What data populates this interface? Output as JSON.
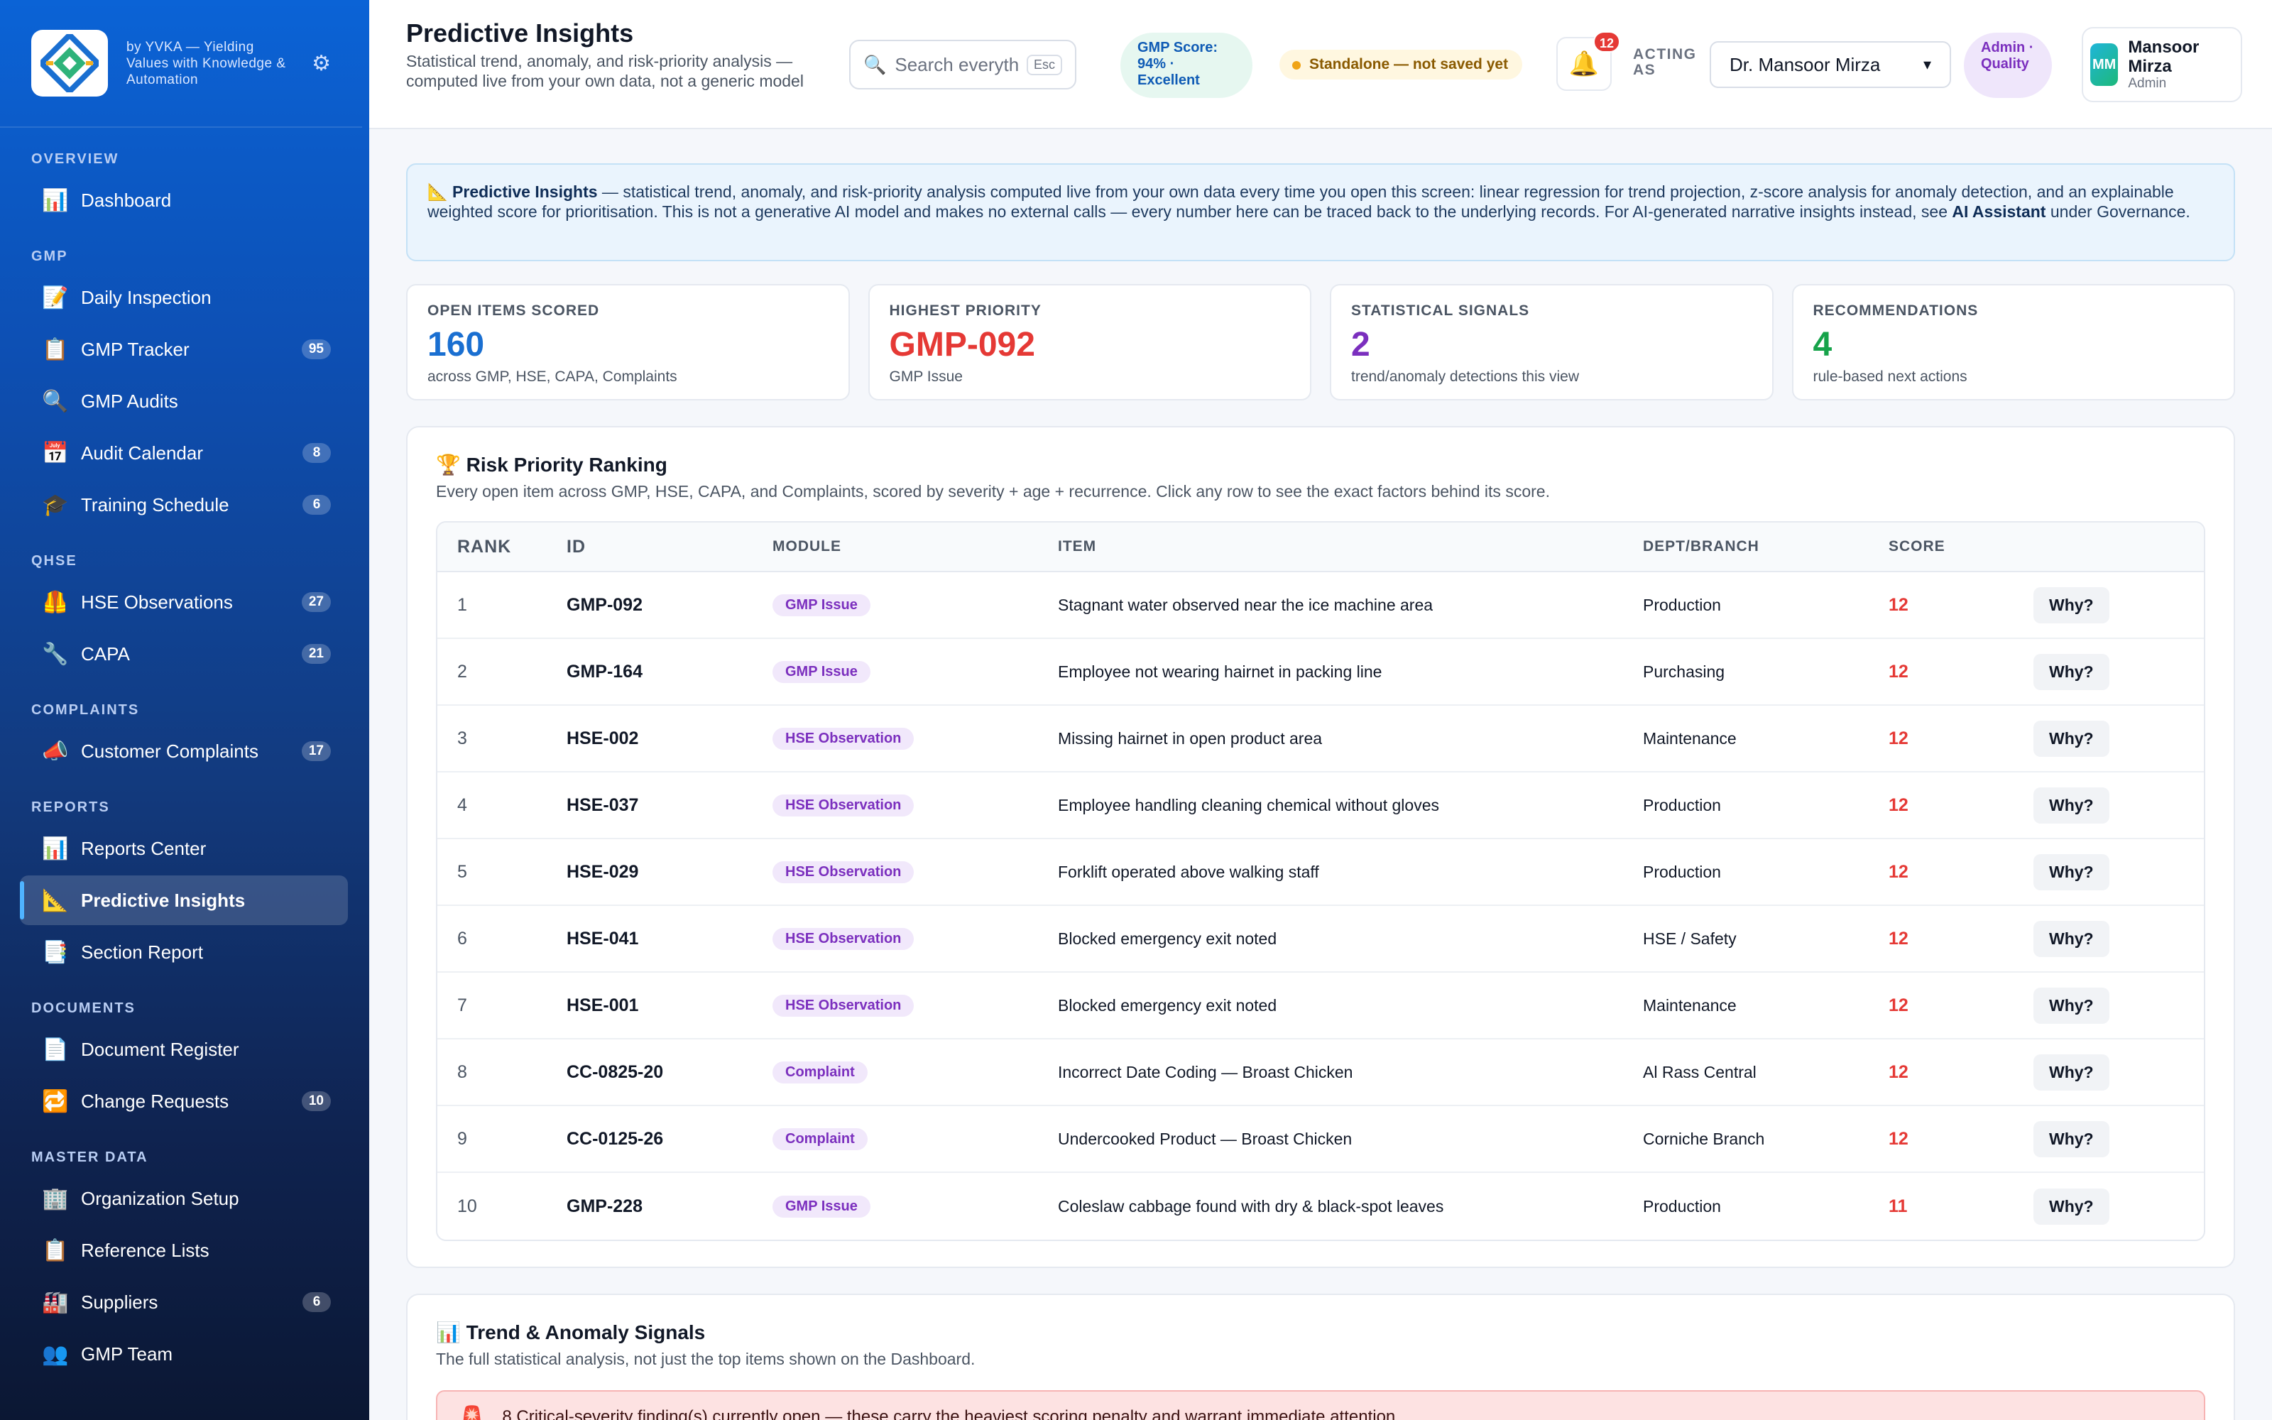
{
  "brand": {
    "tagline": "by YVKA — Yielding Values with Knowledge & Automation"
  },
  "sidebar": {
    "sections": [
      {
        "title": "OVERVIEW",
        "items": [
          {
            "key": "dashboard",
            "label": "Dashboard",
            "icon": "📊"
          }
        ]
      },
      {
        "title": "GMP",
        "items": [
          {
            "key": "daily-inspection",
            "label": "Daily Inspection",
            "icon": "📝"
          },
          {
            "key": "gmp-tracker",
            "label": "GMP Tracker",
            "icon": "📋",
            "badge": "95"
          },
          {
            "key": "gmp-audits",
            "label": "GMP Audits",
            "icon": "🔍"
          },
          {
            "key": "audit-calendar",
            "label": "Audit Calendar",
            "icon": "📅",
            "badge": "8"
          },
          {
            "key": "training-schedule",
            "label": "Training Schedule",
            "icon": "🎓",
            "badge": "6"
          }
        ]
      },
      {
        "title": "QHSE",
        "items": [
          {
            "key": "hse-observations",
            "label": "HSE Observations",
            "icon": "🦺",
            "badge": "27"
          },
          {
            "key": "capa",
            "label": "CAPA",
            "icon": "🔧",
            "badge": "21"
          }
        ]
      },
      {
        "title": "COMPLAINTS",
        "items": [
          {
            "key": "customer-complaints",
            "label": "Customer Complaints",
            "icon": "📣",
            "badge": "17"
          }
        ]
      },
      {
        "title": "REPORTS",
        "items": [
          {
            "key": "reports-center",
            "label": "Reports Center",
            "icon": "📊"
          },
          {
            "key": "predictive-insights",
            "label": "Predictive Insights",
            "icon": "📐",
            "active": true
          },
          {
            "key": "section-report",
            "label": "Section Report",
            "icon": "📑"
          }
        ]
      },
      {
        "title": "DOCUMENTS",
        "items": [
          {
            "key": "document-register",
            "label": "Document Register",
            "icon": "📄"
          },
          {
            "key": "change-requests",
            "label": "Change Requests",
            "icon": "🔁",
            "badge": "10"
          }
        ]
      },
      {
        "title": "MASTER DATA",
        "items": [
          {
            "key": "organization-setup",
            "label": "Organization Setup",
            "icon": "🏢"
          },
          {
            "key": "reference-lists",
            "label": "Reference Lists",
            "icon": "📋"
          },
          {
            "key": "suppliers",
            "label": "Suppliers",
            "icon": "🏭",
            "badge": "6"
          },
          {
            "key": "gmp-team",
            "label": "GMP Team",
            "icon": "👥"
          }
        ]
      }
    ]
  },
  "header": {
    "title": "Predictive Insights",
    "subtitle": "Statistical trend, anomaly, and risk-priority analysis — computed live from your own data, not a generic model",
    "search_placeholder": "Search everyth",
    "search_hint": "Esc",
    "gmp_score": "GMP Score: 94% · Excellent",
    "standalone": "Standalone — not saved yet",
    "notifications_count": "12",
    "acting_label": "ACTING AS",
    "acting_value": "Dr. Mansoor Mirza",
    "role_pill": "Admin · Quality",
    "user": {
      "initials": "MM",
      "name": "Mansoor Mirza",
      "role": "Admin"
    }
  },
  "banner": {
    "icon": "📐",
    "lead": "Predictive Insights",
    "text": " — statistical trend, anomaly, and risk-priority analysis computed live from your own data every time you open this screen: linear regression for trend projection, z-score analysis for anomaly detection, and an explainable weighted score for prioritisation. This is not a generative AI model and makes no external calls — every number here can be traced back to the underlying records. For AI-generated narrative insights instead, see ",
    "link": "AI Assistant",
    "tail": " under Governance."
  },
  "stats": [
    {
      "label": "OPEN ITEMS SCORED",
      "value": "160",
      "sub": "across GMP, HSE, CAPA, Complaints",
      "color": "#1a6fd1"
    },
    {
      "label": "HIGHEST PRIORITY",
      "value": "GMP-092",
      "sub": "GMP Issue",
      "color": "#e53935"
    },
    {
      "label": "STATISTICAL SIGNALS",
      "value": "2",
      "sub": "trend/anomaly detections this view",
      "color": "#7b2fbe"
    },
    {
      "label": "RECOMMENDATIONS",
      "value": "4",
      "sub": "rule-based next actions",
      "color": "#16a34a"
    }
  ],
  "ranking": {
    "icon": "🏆",
    "title": "Risk Priority Ranking",
    "subtitle": "Every open item across GMP, HSE, CAPA, and Complaints, scored by severity + age + recurrence. Click any row to see the exact factors behind its score.",
    "columns": [
      "RANK",
      "ID",
      "MODULE",
      "ITEM",
      "DEPT/BRANCH",
      "SCORE"
    ],
    "action_label": "Why?",
    "rows": [
      {
        "rank": "1",
        "id": "GMP-092",
        "module": "GMP Issue",
        "item": "Stagnant water observed near the ice machine area",
        "dept": "Production",
        "score": "12"
      },
      {
        "rank": "2",
        "id": "GMP-164",
        "module": "GMP Issue",
        "item": "Employee not wearing hairnet in packing line",
        "dept": "Purchasing",
        "score": "12"
      },
      {
        "rank": "3",
        "id": "HSE-002",
        "module": "HSE Observation",
        "item": "Missing hairnet in open product area",
        "dept": "Maintenance",
        "score": "12"
      },
      {
        "rank": "4",
        "id": "HSE-037",
        "module": "HSE Observation",
        "item": "Employee handling cleaning chemical without gloves",
        "dept": "Production",
        "score": "12"
      },
      {
        "rank": "5",
        "id": "HSE-029",
        "module": "HSE Observation",
        "item": "Forklift operated above walking staff",
        "dept": "Production",
        "score": "12"
      },
      {
        "rank": "6",
        "id": "HSE-041",
        "module": "HSE Observation",
        "item": "Blocked emergency exit noted",
        "dept": "HSE / Safety",
        "score": "12"
      },
      {
        "rank": "7",
        "id": "HSE-001",
        "module": "HSE Observation",
        "item": "Blocked emergency exit noted",
        "dept": "Maintenance",
        "score": "12"
      },
      {
        "rank": "8",
        "id": "CC-0825-20",
        "module": "Complaint",
        "item": "Incorrect Date Coding — Broast Chicken",
        "dept": "Al Rass Central",
        "score": "12"
      },
      {
        "rank": "9",
        "id": "CC-0125-26",
        "module": "Complaint",
        "item": "Undercooked Product — Broast Chicken",
        "dept": "Corniche Branch",
        "score": "12"
      },
      {
        "rank": "10",
        "id": "GMP-228",
        "module": "GMP Issue",
        "item": "Coleslaw cabbage found with dry & black-spot leaves",
        "dept": "Production",
        "score": "11"
      }
    ]
  },
  "trend": {
    "icon": "📊",
    "title": "Trend & Anomaly Signals",
    "subtitle": "The full statistical analysis, not just the top items shown on the Dashboard.",
    "alert_icon": "🚨",
    "alert_text": "8 Critical-severity finding(s) currently open — these carry the heaviest scoring penalty and warrant immediate attention."
  }
}
